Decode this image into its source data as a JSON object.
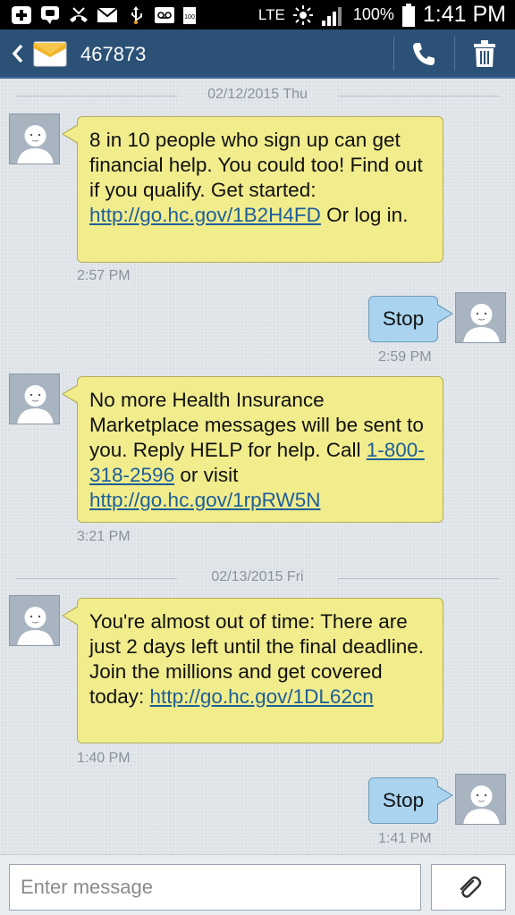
{
  "status_bar": {
    "network": "LTE",
    "battery_percent": "100%",
    "time": "1:41 PM",
    "battery_small_label": "100",
    "icons": [
      "add-icon",
      "chat-icon",
      "missed-call-icon",
      "mail-icon",
      "usb-icon",
      "voicemail-icon",
      "battery-small-icon",
      "lte-icon",
      "brightness-icon",
      "signal-icon",
      "battery-icon"
    ]
  },
  "header": {
    "contact_number": "467873",
    "colors": {
      "bar": "#2c5177"
    }
  },
  "conversation": {
    "date_separators": [
      {
        "label": "02/12/2015 Thu"
      },
      {
        "label": "02/13/2015 Fri"
      }
    ],
    "messages": [
      {
        "direction": "incoming",
        "parts": [
          "8 in 10 people who sign up can get financial help. You could too! Find out if you qualify. Get started: ",
          "http://go.hc.gov/1B2H4FD",
          " Or log in."
        ],
        "time": "2:57 PM"
      },
      {
        "direction": "outgoing",
        "text": "Stop",
        "time": "2:59 PM"
      },
      {
        "direction": "incoming",
        "parts": [
          "No more Health Insurance Marketplace messages will be sent to you. Reply HELP for help. Call ",
          "1-800-318-2596",
          " or visit ",
          "http://go.hc.gov/1rpRW5N"
        ],
        "time": "3:21 PM"
      },
      {
        "direction": "incoming",
        "parts": [
          "You're almost out of time: There are just 2 days left until the final deadline. Join the millions and get covered today: ",
          "http://go.hc.gov/1DL62cn"
        ],
        "time": "1:40 PM"
      },
      {
        "direction": "outgoing",
        "text": "Stop",
        "time": "1:41 PM"
      }
    ],
    "colors": {
      "incoming_bubble": "#f1ec8c",
      "outgoing_bubble": "#a9d3ef",
      "link": "#1d5f9a"
    }
  },
  "composer": {
    "placeholder": "Enter message",
    "value": ""
  }
}
